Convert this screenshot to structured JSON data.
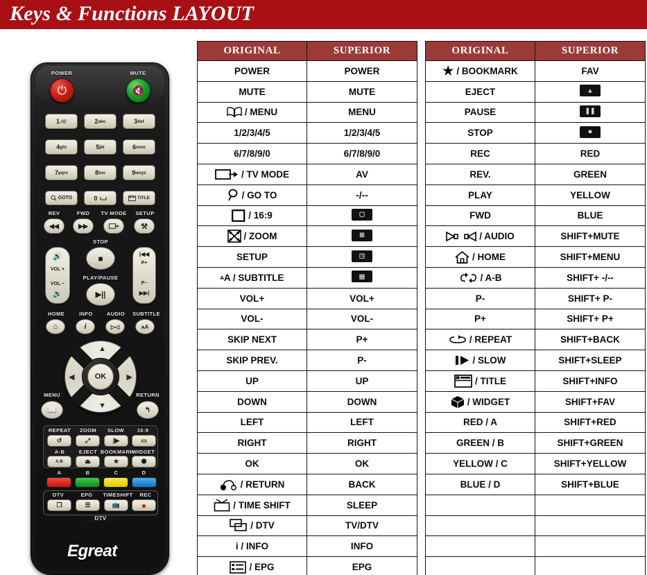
{
  "header": {
    "title": "Keys & Functions LAYOUT",
    "bar_color": "#A81016"
  },
  "colors": {
    "title_bar": "#A81016",
    "table_header": "#9C3A38",
    "border": "#111111",
    "remote_body": "#141414",
    "power_button": "#CC2018",
    "mute_button": "#13A32A",
    "color_key_red": "#E01B12",
    "color_key_green": "#16A427",
    "color_key_yellow": "#F2D90A",
    "color_key_blue": "#1C8FE0"
  },
  "remote": {
    "brand": "Egreat",
    "labels": {
      "power": "POWER",
      "mute": "MUTE",
      "rev": "REV",
      "fwd": "FWD",
      "tv_mode": "TV MODE",
      "setup": "SETUP",
      "stop": "STOP",
      "play_pause": "PLAY/PAUSE",
      "home": "HOME",
      "info": "INFO",
      "audio": "AUDIO",
      "subtitle": "SUBTITLE",
      "menu": "MENU",
      "return": "RETURN",
      "repeat": "REPEAT",
      "zoom": "ZOOM",
      "slow": "SLOW",
      "ratio_169": "16:9",
      "ab": "A-B",
      "eject": "EJECT",
      "bookmark": "BOOKMARK",
      "widget": "WIDGET",
      "key_a": "A",
      "key_b": "B",
      "key_c": "C",
      "key_d": "D",
      "dtv": "DTV",
      "epg": "EPG",
      "timeshift": "TIMESHIFT",
      "rec": "REC",
      "dtv_group": "DTV",
      "vol_plus": "VOL +",
      "vol_minus": "VOL −",
      "p_plus": "P+",
      "p_minus": "P−",
      "ok": "OK"
    },
    "numeric_keys": [
      {
        "digit": "1",
        "letters": "./@"
      },
      {
        "digit": "2",
        "letters": "abc"
      },
      {
        "digit": "3",
        "letters": "def"
      },
      {
        "digit": "4",
        "letters": "ghi"
      },
      {
        "digit": "5",
        "letters": "jkl"
      },
      {
        "digit": "6",
        "letters": "mno"
      },
      {
        "digit": "7",
        "letters": "pqrs"
      },
      {
        "digit": "8",
        "letters": "tuv"
      },
      {
        "digit": "9",
        "letters": "wxyz"
      }
    ],
    "bottom_row_keys": [
      {
        "label": "GOTO",
        "icon": "magnifier-icon"
      },
      {
        "label": "0",
        "icon": "space-icon"
      },
      {
        "label": "TITLE",
        "icon": "title-icon"
      }
    ]
  },
  "tables": {
    "headers": {
      "original": "ORIGINAL",
      "superior": "SUPERIOR"
    },
    "left_rows": [
      {
        "original": "POWER",
        "superior": "POWER"
      },
      {
        "original": "MUTE",
        "superior": "MUTE"
      },
      {
        "original": "/ MENU",
        "original_icon": "book-icon",
        "superior": "MENU"
      },
      {
        "original": "1/2/3/4/5",
        "superior": "1/2/3/4/5"
      },
      {
        "original": "6/7/8/9/0",
        "superior": "6/7/8/9/0"
      },
      {
        "original": "/ TV MODE",
        "original_icon": "tv-mode-icon",
        "superior": "AV"
      },
      {
        "original": "/ GO TO",
        "original_icon": "magnifier-icon",
        "superior": "-/--"
      },
      {
        "original": "/ 16:9",
        "original_icon": "square-icon",
        "superior": "",
        "superior_icon": "screen-chip-icon"
      },
      {
        "original": "/ ZOOM",
        "original_icon": "zoom-arrows-icon",
        "superior": "",
        "superior_icon": "zoom-chip-icon"
      },
      {
        "original": "SETUP",
        "superior": "",
        "superior_icon": "setup-chip-icon"
      },
      {
        "original": "A / SUBTITLE",
        "original_icon": "subtitle-aA-icon",
        "superior": "",
        "superior_icon": "subtitle-chip-icon"
      },
      {
        "original": "VOL+",
        "superior": "VOL+"
      },
      {
        "original": "VOL-",
        "superior": "VOL-"
      },
      {
        "original": "SKIP NEXT",
        "superior": "P+"
      },
      {
        "original": "SKIP PREV.",
        "superior": "P-"
      },
      {
        "original": "UP",
        "superior": "UP"
      },
      {
        "original": "DOWN",
        "superior": "DOWN"
      },
      {
        "original": "LEFT",
        "superior": "LEFT"
      },
      {
        "original": "RIGHT",
        "superior": "RIGHT"
      },
      {
        "original": "OK",
        "superior": "OK"
      },
      {
        "original": "/ RETURN",
        "original_icon": "return-icon",
        "superior": "BACK"
      },
      {
        "original": "/ TIME SHIFT",
        "original_icon": "timeshift-tv-icon",
        "superior": "SLEEP"
      },
      {
        "original": "/ DTV",
        "original_icon": "dtv-windows-icon",
        "superior": "TV/DTV"
      },
      {
        "original": "i / INFO",
        "superior": "INFO"
      },
      {
        "original": "/ EPG",
        "original_icon": "epg-list-icon",
        "superior": "EPG"
      }
    ],
    "right_rows": [
      {
        "original": "/ BOOKMARK",
        "original_icon": "star-icon",
        "superior": "FAV"
      },
      {
        "original": "EJECT",
        "superior": "",
        "superior_icon": "eject-chip-icon"
      },
      {
        "original": "PAUSE",
        "superior": "",
        "superior_icon": "pause-chip-icon"
      },
      {
        "original": "STOP",
        "superior": "",
        "superior_icon": "stop-chip-icon"
      },
      {
        "original": "REC",
        "superior": "RED"
      },
      {
        "original": "REV.",
        "superior": "GREEN"
      },
      {
        "original": "PLAY",
        "superior": "YELLOW"
      },
      {
        "original": "FWD",
        "superior": "BLUE"
      },
      {
        "original": "/ AUDIO",
        "original_icon": "audio-speakers-icon",
        "superior": "SHIFT+MUTE"
      },
      {
        "original": "/ HOME",
        "original_icon": "home-icon",
        "superior": "SHIFT+MENU"
      },
      {
        "original": "/ A-B",
        "original_icon": "ab-repeat-icon",
        "superior": "SHIFT+ -/--"
      },
      {
        "original": "P-",
        "superior": "SHIFT+ P-"
      },
      {
        "original": "P+",
        "superior": "SHIFT+ P+"
      },
      {
        "original": "/ REPEAT",
        "original_icon": "repeat-icon",
        "superior": "SHIFT+BACK"
      },
      {
        "original": "/ SLOW",
        "original_icon": "slow-icon",
        "superior": "SHIFT+SLEEP"
      },
      {
        "original": "/ TITLE",
        "original_icon": "title-window-icon",
        "superior": "SHIFT+INFO"
      },
      {
        "original": "/ WIDGET",
        "original_icon": "widget-cube-icon",
        "superior": "SHIFT+FAV"
      },
      {
        "original": "RED / A",
        "superior": "SHIFT+RED"
      },
      {
        "original": "GREEN / B",
        "superior": "SHIFT+GREEN"
      },
      {
        "original": "YELLOW / C",
        "superior": "SHIFT+YELLOW"
      },
      {
        "original": "BLUE / D",
        "superior": "SHIFT+BLUE"
      },
      {
        "original": "",
        "superior": ""
      },
      {
        "original": "",
        "superior": ""
      },
      {
        "original": "",
        "superior": ""
      },
      {
        "original": "",
        "superior": ""
      }
    ]
  }
}
